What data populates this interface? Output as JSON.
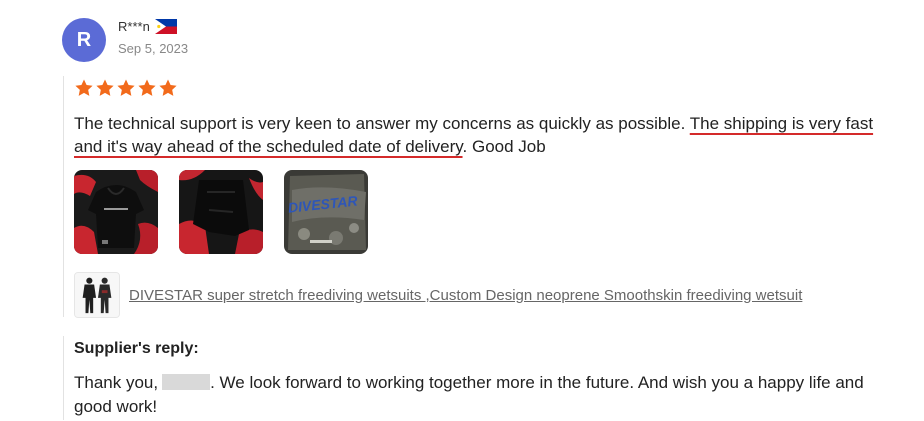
{
  "reviewer": {
    "avatar_letter": "R",
    "avatar_color": "#5b6bd6",
    "name": "R***n",
    "country_flag": "philippines-flag-icon",
    "date": "Sep 5, 2023"
  },
  "rating": {
    "stars": 5,
    "max": 5,
    "color": "#f26a1b"
  },
  "review": {
    "text_before": "The technical support is very keen to answer my concerns as quickly as possible. ",
    "text_highlighted": "The shipping is very fast and it's way ahead of the scheduled date of delivery",
    "text_after": ". Good Job",
    "underline_color": "#d42a2a"
  },
  "photos": [
    {
      "name": "review-photo-hoodie-icon"
    },
    {
      "name": "review-photo-wetsuit-icon"
    },
    {
      "name": "review-photo-package-icon",
      "label": "DIVESTAR"
    }
  ],
  "product": {
    "thumbnail": "wetsuit-thumbnail-icon",
    "link_text": "DIVESTAR super stretch freediving wetsuits ,Custom Design neoprene Smoothskin freediving wetsuit"
  },
  "supplier_reply": {
    "title": "Supplier's reply:",
    "text_before": "Thank you,",
    "text_after": ". We look forward to working together more in the future. And wish you a happy life and good work!"
  }
}
